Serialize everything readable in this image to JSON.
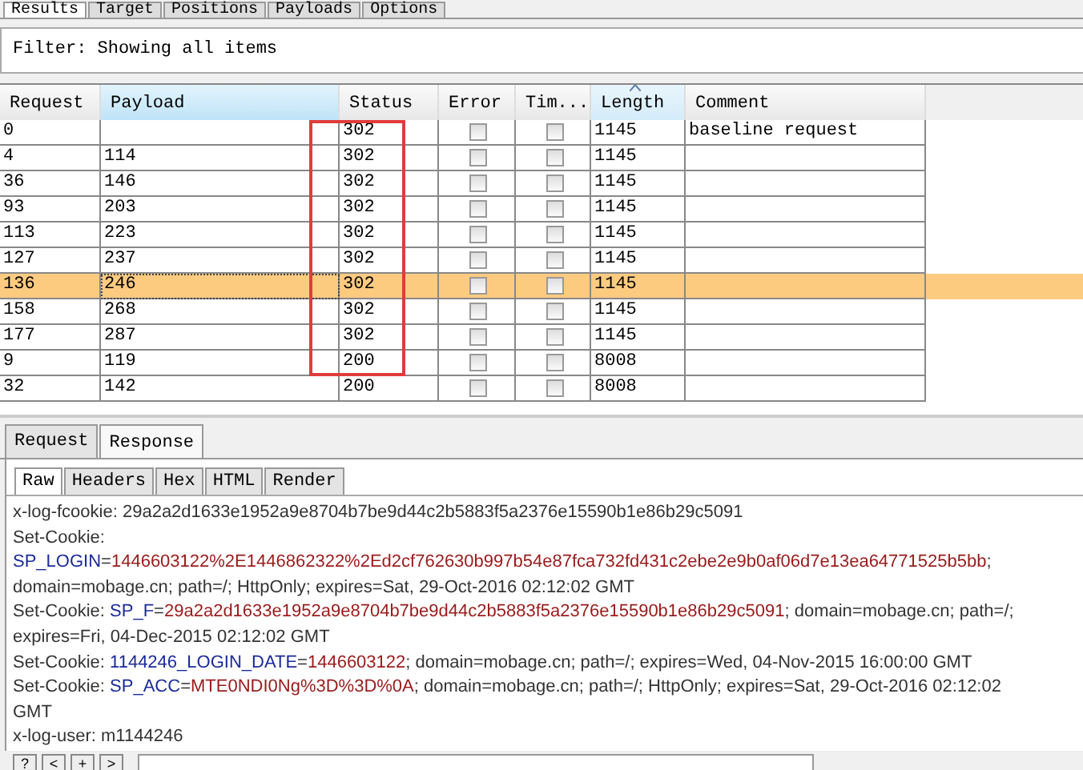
{
  "tabs": [
    {
      "label": "Results",
      "selected": true
    },
    {
      "label": "Target",
      "selected": false
    },
    {
      "label": "Positions",
      "selected": false
    },
    {
      "label": "Payloads",
      "selected": false
    },
    {
      "label": "Options",
      "selected": false
    }
  ],
  "filter": "Filter: Showing all items",
  "table": {
    "columns": [
      {
        "label": "Request",
        "sorted": false
      },
      {
        "label": "Payload",
        "sorted": false
      },
      {
        "label": "Status",
        "sorted": false
      },
      {
        "label": "Error",
        "sorted": false
      },
      {
        "label": "Tim...",
        "sorted": false
      },
      {
        "label": "Length",
        "sorted": true
      },
      {
        "label": "Comment",
        "sorted": false
      }
    ],
    "rows": [
      {
        "request": "0",
        "payload": "",
        "status": "302",
        "error": false,
        "timeout": false,
        "length": "1145",
        "comment": "baseline request",
        "selected": false,
        "boxed": true
      },
      {
        "request": "4",
        "payload": "114",
        "status": "302",
        "error": false,
        "timeout": false,
        "length": "1145",
        "selected": false,
        "boxed": true
      },
      {
        "request": "36",
        "payload": "146",
        "status": "302",
        "error": false,
        "timeout": false,
        "length": "1145",
        "selected": false,
        "boxed": true
      },
      {
        "request": "93",
        "payload": "203",
        "status": "302",
        "error": false,
        "timeout": false,
        "length": "1145",
        "selected": false,
        "boxed": true
      },
      {
        "request": "113",
        "payload": "223",
        "status": "302",
        "error": false,
        "timeout": false,
        "length": "1145",
        "selected": false,
        "boxed": true
      },
      {
        "request": "127",
        "payload": "237",
        "status": "302",
        "error": false,
        "timeout": false,
        "length": "1145",
        "selected": false,
        "boxed": true
      },
      {
        "request": "136",
        "payload": "246",
        "status": "302",
        "error": false,
        "timeout": false,
        "length": "1145",
        "selected": true,
        "boxed": true
      },
      {
        "request": "158",
        "payload": "268",
        "status": "302",
        "error": false,
        "timeout": false,
        "length": "1145",
        "selected": false,
        "boxed": true
      },
      {
        "request": "177",
        "payload": "287",
        "status": "302",
        "error": false,
        "timeout": false,
        "length": "1145",
        "selected": false,
        "boxed": true
      },
      {
        "request": "9",
        "payload": "119",
        "status": "200",
        "error": false,
        "timeout": false,
        "length": "8008",
        "selected": false,
        "boxed": true
      },
      {
        "request": "32",
        "payload": "142",
        "status": "200",
        "error": false,
        "timeout": false,
        "length": "8008",
        "selected": false,
        "boxed": false
      }
    ]
  },
  "message_tabs": [
    {
      "label": "Request",
      "selected": false
    },
    {
      "label": "Response",
      "selected": true
    }
  ],
  "view_tabs": [
    {
      "label": "Raw",
      "selected": true
    },
    {
      "label": "Headers",
      "selected": false
    },
    {
      "label": "Hex",
      "selected": false
    },
    {
      "label": "HTML",
      "selected": false
    },
    {
      "label": "Render",
      "selected": false
    }
  ],
  "response_lines": [
    [
      {
        "kind": "plain",
        "text": "x-log-fcookie: 29a2a2d1633e1952a9e8704b7be9d44c2b5883f5a2376e15590b1e86b29c5091"
      }
    ],
    [
      {
        "kind": "plain",
        "text": "Set-Cookie:"
      }
    ],
    [
      {
        "kind": "name",
        "text": "SP_LOGIN"
      },
      {
        "kind": "plain",
        "text": "="
      },
      {
        "kind": "value",
        "text": "1446603122%2E1446862322%2Ed2cf762630b997b54e87fca732fd431c2ebe2e9b0af06d7e13ea64771525b5bb"
      },
      {
        "kind": "plain",
        "text": ";"
      }
    ],
    [
      {
        "kind": "plain",
        "text": "domain=mobage.cn; path=/; HttpOnly; expires=Sat, 29-Oct-2016 02:12:02 GMT"
      }
    ],
    [
      {
        "kind": "plain",
        "text": "Set-Cookie: "
      },
      {
        "kind": "name",
        "text": "SP_F"
      },
      {
        "kind": "plain",
        "text": "="
      },
      {
        "kind": "value",
        "text": "29a2a2d1633e1952a9e8704b7be9d44c2b5883f5a2376e15590b1e86b29c5091"
      },
      {
        "kind": "plain",
        "text": "; domain=mobage.cn; path=/;"
      }
    ],
    [
      {
        "kind": "plain",
        "text": "expires=Fri, 04-Dec-2015 02:12:02 GMT"
      }
    ],
    [
      {
        "kind": "plain",
        "text": "Set-Cookie: "
      },
      {
        "kind": "name",
        "text": "1144246_LOGIN_DATE"
      },
      {
        "kind": "plain",
        "text": "="
      },
      {
        "kind": "value",
        "text": "1446603122"
      },
      {
        "kind": "plain",
        "text": "; domain=mobage.cn; path=/; expires=Wed, 04-Nov-2015 16:00:00 GMT"
      }
    ],
    [
      {
        "kind": "plain",
        "text": "Set-Cookie: "
      },
      {
        "kind": "name",
        "text": "SP_ACC"
      },
      {
        "kind": "plain",
        "text": "="
      },
      {
        "kind": "value",
        "text": "MTE0NDI0Ng%3D%3D%0A"
      },
      {
        "kind": "plain",
        "text": "; domain=mobage.cn; path=/; HttpOnly; expires=Sat, 29-Oct-2016 02:12:02"
      }
    ],
    [
      {
        "kind": "plain",
        "text": "GMT"
      }
    ],
    [
      {
        "kind": "plain",
        "text": "x-log-user: m1144246"
      }
    ]
  ],
  "bottom_buttons": [
    "?",
    "<",
    "+",
    ">"
  ]
}
